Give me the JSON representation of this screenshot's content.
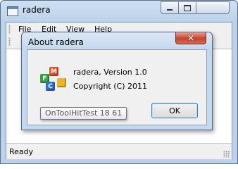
{
  "window": {
    "title": "radera",
    "menu": [
      "File",
      "Edit",
      "View",
      "Help"
    ],
    "status": "Ready"
  },
  "dialog": {
    "title": "About radera",
    "close_glyph": "✕",
    "icon": "mfc-app-icon",
    "version_text": "radera, Version 1.0",
    "copyright_text": "Copyright (C) 2011",
    "ok_label": "OK"
  },
  "tooltip": {
    "text": "OnToolHitTest 18 61"
  },
  "icon_letters": {
    "m": "M",
    "f": "F",
    "c": "C"
  },
  "colors": {
    "frame": "#bcd2ea",
    "close_button": "#c64330",
    "ok_border": "#3c7fb1"
  }
}
